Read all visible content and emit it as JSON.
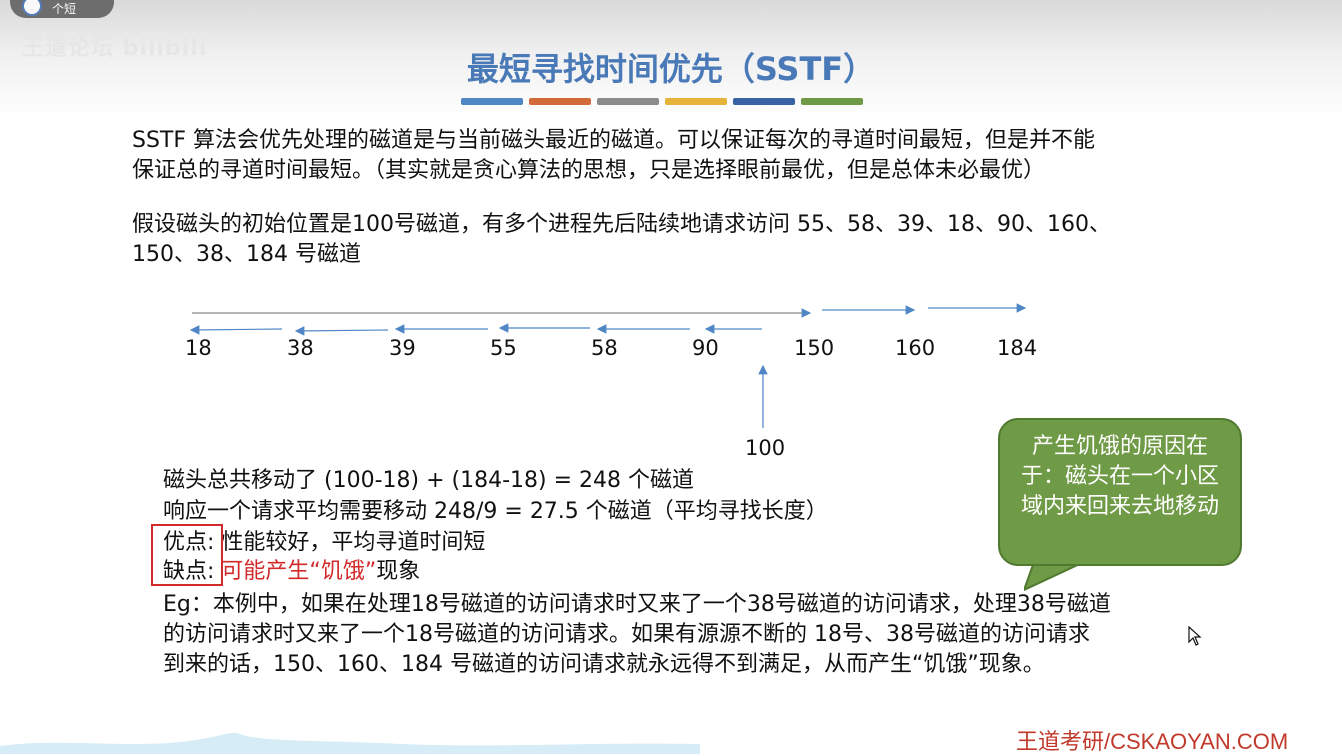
{
  "player": {
    "label": "个短"
  },
  "watermark": "王道论坛 bilibili",
  "title": "最短寻找时间优先（SSTF）",
  "title_stripe_colors": [
    "#4f86c6",
    "#d46a3a",
    "#8c8c8c",
    "#e8b33a",
    "#3a63a6",
    "#6f9a46"
  ],
  "intro": {
    "line1": "SSTF 算法会优先处理的磁道是与当前磁头最近的磁道。可以保证每次的寻道时间最短，但是并不能",
    "line2": "保证总的寻道时间最短。（其实就是贪心算法的思想，只是选择眼前最优，但是总体未必最优）"
  },
  "assumption": {
    "line1": "假设磁头的初始位置是100号磁道，有多个进程先后陆续地请求访问 55、58、39、18、90、160、",
    "line2": "150、38、184 号磁道"
  },
  "axis": {
    "ticks": [
      "18",
      "38",
      "39",
      "55",
      "58",
      "90",
      "150",
      "160",
      "184"
    ],
    "start_label": "100"
  },
  "summary": {
    "total": "磁头总共移动了 (100-18) + (184-18) = 248 个磁道",
    "average": "响应一个请求平均需要移动 248/9 = 27.5 个磁道（平均寻找长度）",
    "pros_label": "优点:",
    "pros_text": "性能较好，平均寻道时间短",
    "cons_label": "缺点:",
    "cons_red": "可能产生“饥饿”",
    "cons_rest": "现象"
  },
  "example": {
    "line1": "Eg：本例中，如果在处理18号磁道的访问请求时又来了一个38号磁道的访问请求，处理38号磁道",
    "line2": "的访问请求时又来了一个18号磁道的访问请求。如果有源源不断的 18号、38号磁道的访问请求",
    "line3": "到来的话，150、160、184 号磁道的访问请求就永远得不到满足，从而产生“饥饿”现象。"
  },
  "callout": {
    "text": "产生饥饿的原因在于：磁头在一个小区域内来回来去地移动"
  },
  "footer": "王道考研/CSKAOYAN.COM"
}
